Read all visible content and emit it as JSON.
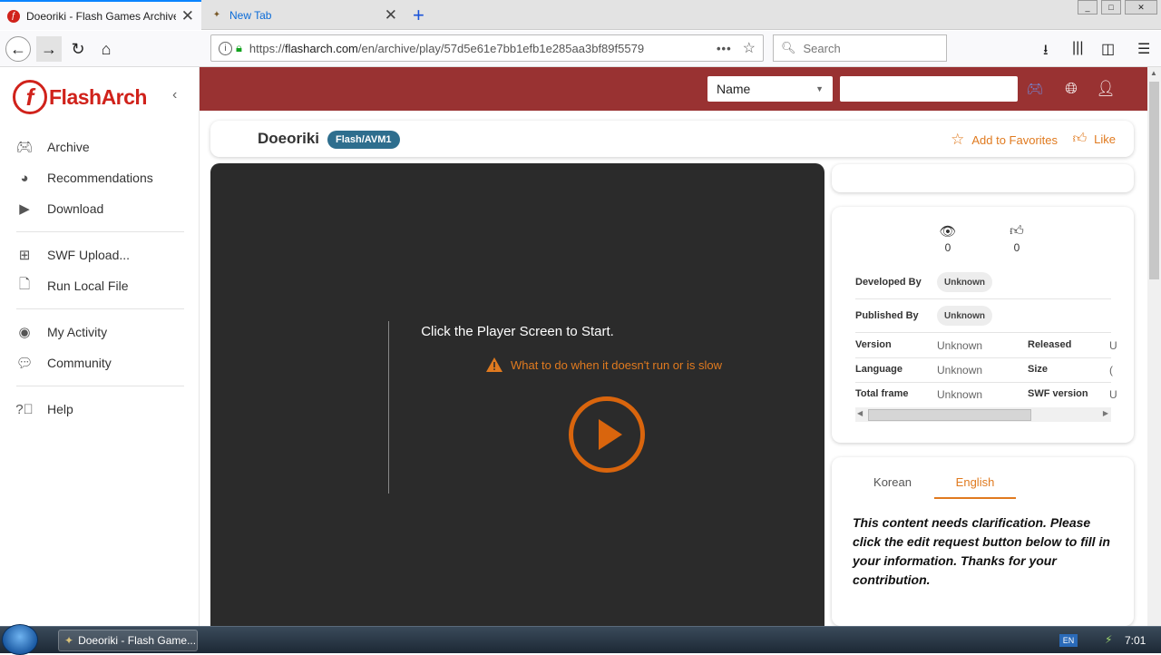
{
  "browser": {
    "tabs": [
      {
        "title": "Doeoriki - Flash Games Archive | F",
        "active": true
      },
      {
        "title": "New Tab",
        "active": false
      }
    ],
    "url_prefix": "https://",
    "url_host": "flasharch.com",
    "url_path": "/en/archive/play/57d5e61e7bb1efb1e285aa3bf89f5579",
    "search_placeholder": "Search"
  },
  "sidebar": {
    "logo_text": "FlashArch",
    "groups": [
      [
        {
          "label": "Archive",
          "icon": "gamepad-icon"
        },
        {
          "label": "Recommendations",
          "icon": "compass-icon"
        },
        {
          "label": "Download",
          "icon": "play-box-icon"
        }
      ],
      [
        {
          "label": "SWF Upload...",
          "icon": "plus-box-icon"
        },
        {
          "label": "Run Local File",
          "icon": "file-icon"
        }
      ],
      [
        {
          "label": "My Activity",
          "icon": "user-circle-icon"
        },
        {
          "label": "Community",
          "icon": "chat-icon"
        }
      ],
      [
        {
          "label": "Help",
          "icon": "help-circle-icon"
        }
      ]
    ]
  },
  "topbar": {
    "sort_value": "Name",
    "accent": "#993232"
  },
  "game": {
    "title": "Doeoriki",
    "platform": "Flash/AVM1",
    "add_favorites": "Add to Favorites",
    "like": "Like",
    "player_message": "Click the Player Screen to Start.",
    "help_link": "What to do when it doesn't run or is slow"
  },
  "info": {
    "views": "0",
    "likes": "0",
    "developed_by_label": "Developed By",
    "developed_by": "Unknown",
    "published_by_label": "Published By",
    "published_by": "Unknown",
    "table": [
      {
        "k1": "Version",
        "v1": "Unknown",
        "k2": "Released",
        "v2": "U"
      },
      {
        "k1": "Language",
        "v1": "Unknown",
        "k2": "Size",
        "v2": "("
      },
      {
        "k1": "Total frame",
        "v1": "Unknown",
        "k2": "SWF version",
        "v2": "U"
      }
    ]
  },
  "description": {
    "tabs": [
      "Korean",
      "English"
    ],
    "active_tab": "English",
    "notice": "This content needs clarification. Please click the edit request button below to fill in your information. Thanks for your contribution."
  },
  "taskbar": {
    "item": "Doeoriki - Flash Game...",
    "lang": "EN",
    "clock": "7:01"
  }
}
